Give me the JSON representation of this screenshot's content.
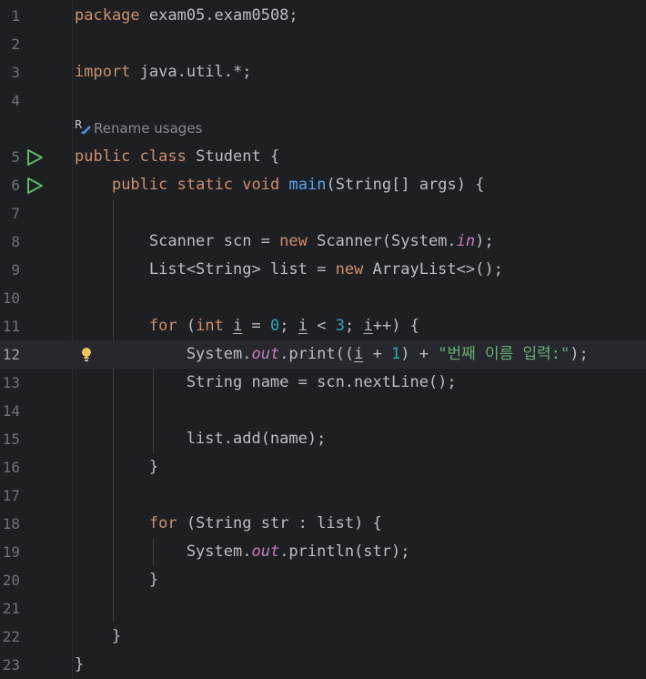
{
  "editor": {
    "hint": {
      "label": "Rename usages",
      "icon": "rename-refactor-icon"
    },
    "current_line": 12,
    "colors": {
      "background": "#1e1f22",
      "keyword": "#cf8e6d",
      "method": "#56a8f5",
      "number": "#2aacb8",
      "string": "#6aab73",
      "static_field": "#c77dbb",
      "default_text": "#bcbec4",
      "line_number": "#6f737a",
      "run_icon": "#5fb865",
      "bulb_icon": "#f2c55c"
    },
    "lines": [
      {
        "number": "1",
        "tokens": [
          {
            "t": "package",
            "c": "kw"
          },
          {
            "t": " exam05.exam0508;"
          }
        ]
      },
      {
        "number": "2",
        "tokens": []
      },
      {
        "number": "3",
        "tokens": [
          {
            "t": "import",
            "c": "kw"
          },
          {
            "t": " java.util.*;"
          }
        ]
      },
      {
        "number": "4",
        "tokens": []
      },
      {
        "number": "5",
        "run": true,
        "tokens": [
          {
            "t": "public",
            "c": "kw"
          },
          {
            "t": " "
          },
          {
            "t": "class",
            "c": "kw"
          },
          {
            "t": " Student {"
          }
        ]
      },
      {
        "number": "6",
        "run": true,
        "tokens": [
          {
            "t": "    "
          },
          {
            "t": "public",
            "c": "kw"
          },
          {
            "t": " "
          },
          {
            "t": "static",
            "c": "kw"
          },
          {
            "t": " "
          },
          {
            "t": "void",
            "c": "kw"
          },
          {
            "t": " "
          },
          {
            "t": "main",
            "c": "fn"
          },
          {
            "t": "(String[] args) {"
          }
        ]
      },
      {
        "number": "7",
        "tokens": []
      },
      {
        "number": "8",
        "tokens": [
          {
            "t": "        Scanner scn = "
          },
          {
            "t": "new",
            "c": "kw"
          },
          {
            "t": " Scanner(System."
          },
          {
            "t": "in",
            "c": "stat"
          },
          {
            "t": ");"
          }
        ]
      },
      {
        "number": "9",
        "tokens": [
          {
            "t": "        List<String> list = "
          },
          {
            "t": "new",
            "c": "kw"
          },
          {
            "t": " ArrayList<>();"
          }
        ]
      },
      {
        "number": "10",
        "tokens": []
      },
      {
        "number": "11",
        "tokens": [
          {
            "t": "        "
          },
          {
            "t": "for",
            "c": "kw"
          },
          {
            "t": " ("
          },
          {
            "t": "int",
            "c": "kw"
          },
          {
            "t": " "
          },
          {
            "t": "i",
            "c": "var"
          },
          {
            "t": " = "
          },
          {
            "t": "0",
            "c": "num"
          },
          {
            "t": "; "
          },
          {
            "t": "i",
            "c": "var"
          },
          {
            "t": " < "
          },
          {
            "t": "3",
            "c": "num"
          },
          {
            "t": "; "
          },
          {
            "t": "i",
            "c": "var"
          },
          {
            "t": "++) {"
          }
        ]
      },
      {
        "number": "12",
        "bulb": true,
        "tokens": [
          {
            "t": "            System."
          },
          {
            "t": "out",
            "c": "stat"
          },
          {
            "t": ".print(("
          },
          {
            "t": "i",
            "c": "var"
          },
          {
            "t": " + "
          },
          {
            "t": "1",
            "c": "num"
          },
          {
            "t": ") + "
          },
          {
            "t": "\"번째 이름 입력:\"",
            "c": "str"
          },
          {
            "t": ");"
          }
        ]
      },
      {
        "number": "13",
        "tokens": [
          {
            "t": "            String name = scn.nextLine();"
          }
        ]
      },
      {
        "number": "14",
        "tokens": []
      },
      {
        "number": "15",
        "tokens": [
          {
            "t": "            list.add(name);"
          }
        ]
      },
      {
        "number": "16",
        "tokens": [
          {
            "t": "        }"
          }
        ]
      },
      {
        "number": "17",
        "tokens": []
      },
      {
        "number": "18",
        "tokens": [
          {
            "t": "        "
          },
          {
            "t": "for",
            "c": "kw"
          },
          {
            "t": " (String str : list) {"
          }
        ]
      },
      {
        "number": "19",
        "tokens": [
          {
            "t": "            System."
          },
          {
            "t": "out",
            "c": "stat"
          },
          {
            "t": ".println(str);"
          }
        ]
      },
      {
        "number": "20",
        "tokens": [
          {
            "t": "        }"
          }
        ]
      },
      {
        "number": "21",
        "tokens": []
      },
      {
        "number": "22",
        "tokens": [
          {
            "t": "    }"
          }
        ]
      },
      {
        "number": "23",
        "tokens": [
          {
            "t": "}"
          }
        ]
      }
    ]
  }
}
